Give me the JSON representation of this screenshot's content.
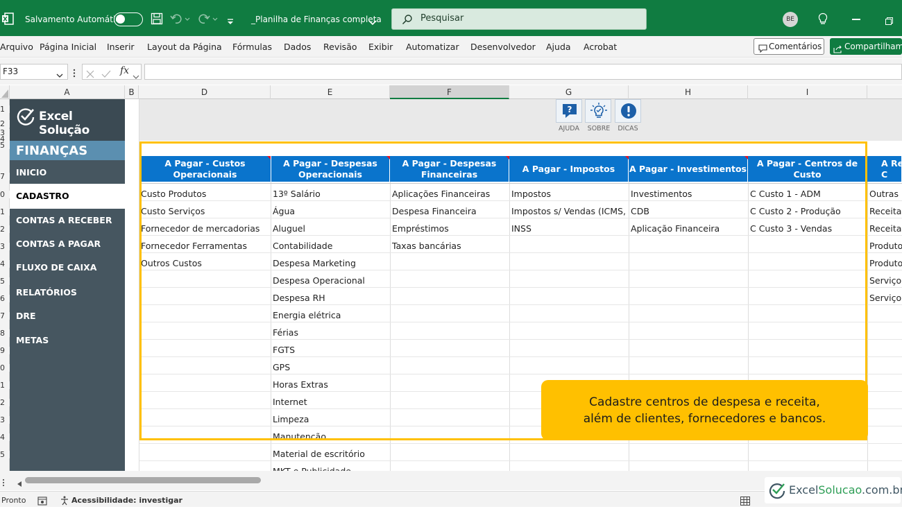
{
  "titlebar": {
    "autosave_label": "Salvamento Automático",
    "filename": "_Planilha de Finanças completa",
    "search_placeholder": "Pesquisar",
    "avatar_initials": "BE"
  },
  "menu": {
    "items": [
      "Arquivo",
      "Página Inicial",
      "Inserir",
      "Layout da Página",
      "Fórmulas",
      "Dados",
      "Revisão",
      "Exibir",
      "Automatizar",
      "Desenvolvedor",
      "Ajuda",
      "Acrobat"
    ],
    "comments_label": "Comentários",
    "share_label": "Compartilham"
  },
  "formula": {
    "cell_ref": "F33",
    "fx_symbol": "fx",
    "value": ""
  },
  "columns": [
    "A",
    "B",
    "D",
    "E",
    "F",
    "G",
    "H",
    "I"
  ],
  "row_numbers": [
    "1",
    "2",
    "3",
    "4",
    "5",
    "7",
    "0",
    "1",
    "2",
    "3",
    "4",
    "5",
    "6",
    "7",
    "8",
    "9",
    "0",
    "1",
    "2",
    "3",
    "4",
    "5"
  ],
  "sidebar": {
    "logo_text": "Excel Solução",
    "section_title": "FINANÇAS",
    "items": [
      "INICIO",
      "CADASTRO",
      "CONTAS A RECEBER",
      "CONTAS A PAGAR",
      "FLUXO DE CAIXA",
      "RELATÓRIOS",
      "DRE",
      "METAS"
    ],
    "active_item": "CADASTRO"
  },
  "toolbar_icons": [
    {
      "label": "AJUDA",
      "icon": "help-chat-icon"
    },
    {
      "label": "SOBRE",
      "icon": "lightbulb-icon"
    },
    {
      "label": "DICAS",
      "icon": "exclamation-icon"
    }
  ],
  "table": {
    "headers": [
      [
        "A Pagar - Custos",
        "Operacionais"
      ],
      [
        "A Pagar - Despesas",
        "Operacionais"
      ],
      [
        "A Pagar - Despesas",
        "Financeiras"
      ],
      [
        "A Pagar - Impostos"
      ],
      [
        "A Pagar - Investimentos"
      ],
      [
        "A Pagar - Centros de",
        "Custo"
      ],
      [
        "A Re",
        "C"
      ]
    ],
    "col_custos": [
      "Custo Produtos",
      "Custo Serviços",
      "Fornecedor de mercadorias",
      "Fornecedor Ferramentas",
      "Outros Custos"
    ],
    "col_despesas_op": [
      "13º Salário",
      "Água",
      "Aluguel",
      "Contabilidade",
      "Despesa Marketing",
      "Despesa Operacional",
      "Despesa RH",
      "Energia elétrica",
      "Férias",
      "FGTS",
      "GPS",
      "Horas Extras",
      "Internet",
      "Limpeza",
      "Manutenção",
      "Material de escritório",
      "MKT e Publicidade"
    ],
    "col_despesas_fin": [
      "Aplicações Financeiras",
      "Despesa Financeira",
      "Empréstimos",
      "Taxas bancárias"
    ],
    "col_impostos": [
      "Impostos",
      "Impostos s/ Vendas (ICMS, I",
      "INSS"
    ],
    "col_investimentos": [
      "Investimentos",
      "CDB",
      "Aplicação Financeira"
    ],
    "col_centros": [
      "C Custo 1 - ADM",
      "C Custo 2 - Produção",
      "C Custo 3 - Vendas"
    ],
    "col_receitas": [
      "Outras R",
      "Receita",
      "Receita",
      "Produto",
      "Produto",
      "Serviço",
      "Serviço"
    ]
  },
  "callout": {
    "line1": "Cadastre centros de despesa e receita,",
    "line2": "além de clientes, fornecedores e bancos."
  },
  "status": {
    "ready": "Pronto",
    "accessibility": "Acessibilidade: investigar"
  },
  "watermark": {
    "part1": "Excel",
    "part2": "Solucao",
    "part3": ".com.br"
  },
  "colors": {
    "excel_green": "#107c41",
    "header_blue": "#0a74cc",
    "sidebar": "#465660",
    "sidebar_section": "#5b8fb0",
    "highlight": "#ffc000"
  }
}
